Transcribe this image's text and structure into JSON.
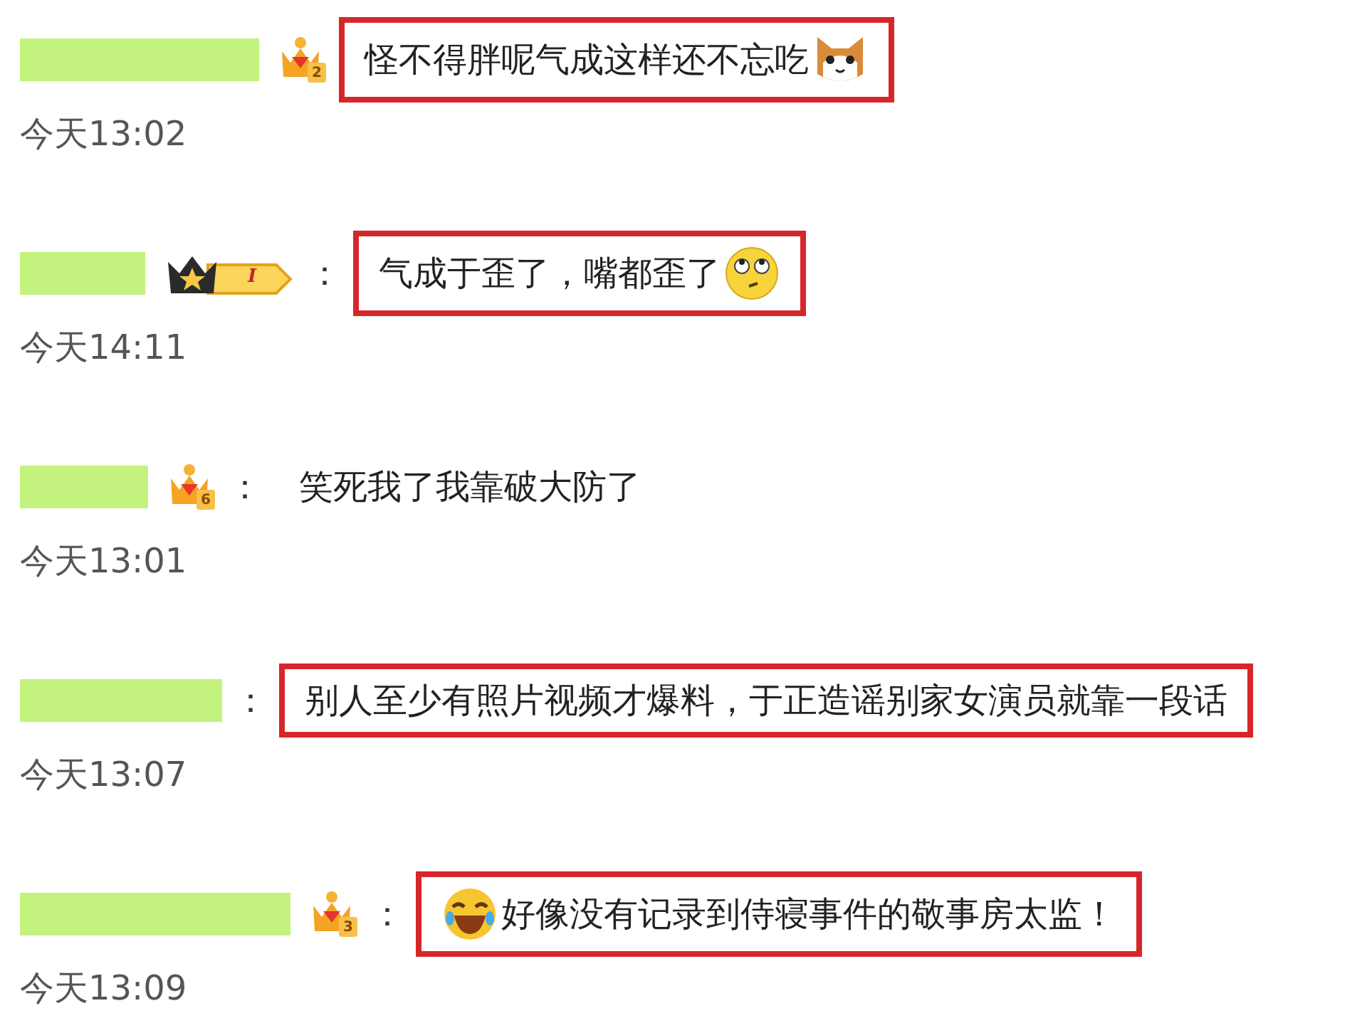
{
  "comments": [
    {
      "highlighted": true,
      "badge": {
        "kind": "crown",
        "label": "2"
      },
      "text": "怪不得胖呢气成这样还不忘吃",
      "emoji_after": {
        "kind": "cat"
      },
      "time": "今天13:02"
    },
    {
      "highlighted": true,
      "colon": "：",
      "badge": {
        "kind": "vip",
        "label": "I"
      },
      "text": "气成于歪了，嘴都歪了",
      "emoji_after": {
        "kind": "eyeroll"
      },
      "time": "今天14:11"
    },
    {
      "highlighted": false,
      "colon": "：",
      "badge": {
        "kind": "crown",
        "label": "6"
      },
      "text": "笑死我了我靠破大防了",
      "time": "今天13:01"
    },
    {
      "highlighted": true,
      "colon": "：",
      "text": "别人至少有照片视频才爆料，于正造谣别家女演员就靠一段话",
      "time": "今天13:07"
    },
    {
      "highlighted": true,
      "colon": "：",
      "badge": {
        "kind": "crown",
        "label": "3"
      },
      "emoji_before": {
        "kind": "laugh"
      },
      "text": "好像没有记录到侍寝事件的敬事房太监！",
      "time": "今天13:09"
    }
  ]
}
